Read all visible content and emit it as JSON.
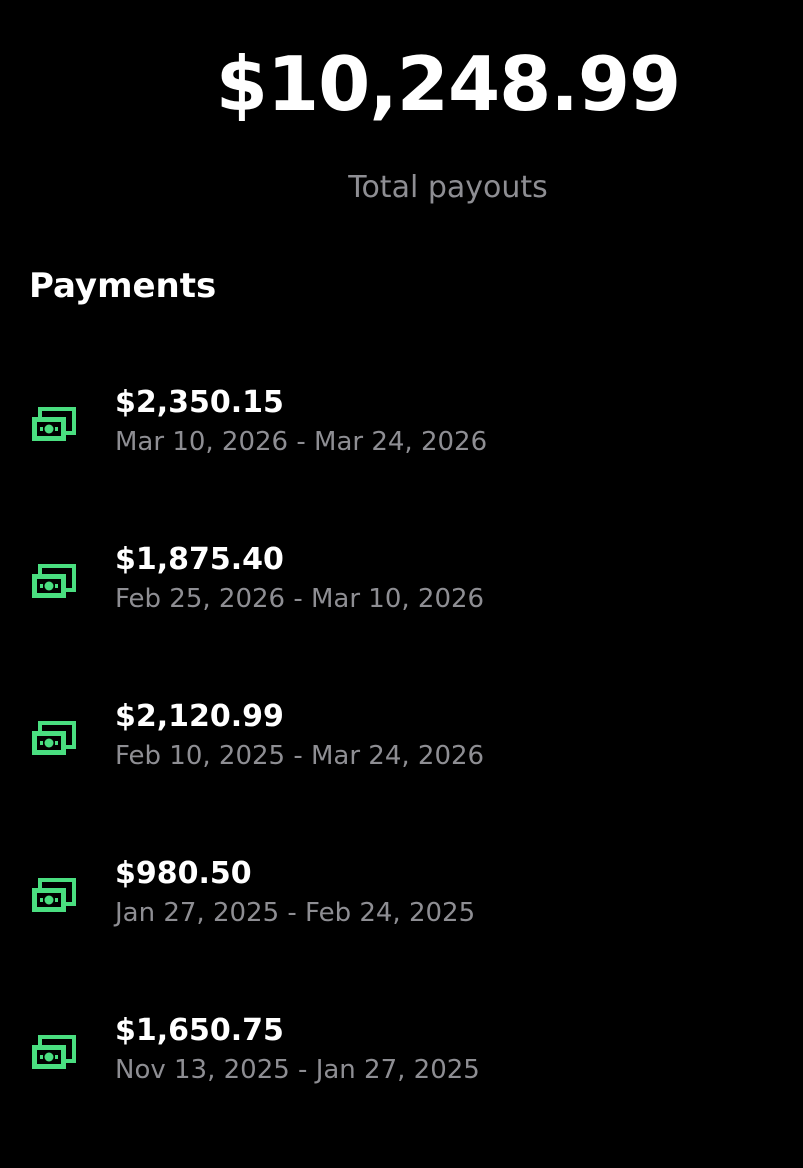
{
  "summary": {
    "total_amount": "$10,248.99",
    "total_label": "Total payouts"
  },
  "payments": {
    "title": "Payments",
    "icon": "cash-icon",
    "icon_color": "#4ade80",
    "items": [
      {
        "amount": "$2,350.15",
        "range": "Mar 10, 2026 - Mar 24, 2026"
      },
      {
        "amount": "$1,875.40",
        "range": "Feb 25, 2026 - Mar 10, 2026"
      },
      {
        "amount": "$2,120.99",
        "range": "Feb 10, 2025 - Mar 24, 2026"
      },
      {
        "amount": "$980.50",
        "range": "Jan 27, 2025 - Feb 24, 2025"
      },
      {
        "amount": "$1,650.75",
        "range": "Nov 13, 2025 - Jan 27, 2025"
      }
    ]
  }
}
